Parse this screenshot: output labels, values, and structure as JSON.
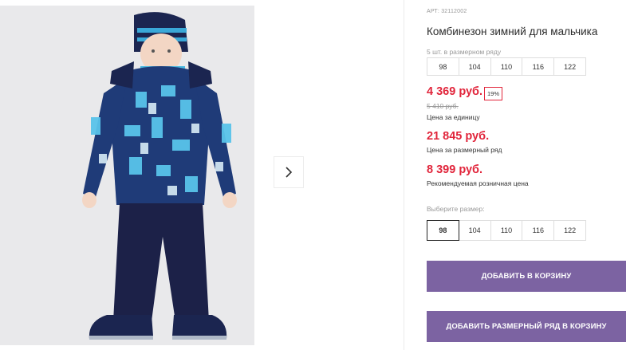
{
  "product": {
    "article": "АРТ: 32112002",
    "title": "Комбинезон зимний для мальчика",
    "pack_label": "5 шт. в размерном ряду",
    "pack_sizes": [
      "98",
      "104",
      "110",
      "116",
      "122"
    ],
    "price": "4 369 руб.",
    "discount_badge": "19%",
    "old_price": "5 410 руб.",
    "price_note": "Цена за единицу",
    "row_price": "21 845 руб.",
    "row_price_note": "Цена за размерный ряд",
    "rrp": "8 399 руб.",
    "rrp_note": "Рекомендуемая розничная цена",
    "choose_size_label": "Выберите размер:",
    "sizes": [
      "98",
      "104",
      "110",
      "116",
      "122"
    ],
    "selected_size": "98",
    "add_to_cart": "ДОБАВИТЬ В КОРЗИНУ",
    "add_row_to_cart": "ДОБАВИТЬ РАЗМЕРНЫЙ РЯД В КОРЗИНУ"
  },
  "colors": {
    "price_red": "#e1253b",
    "button_purple": "#7c63a2"
  },
  "icons": {
    "next": "chevron-right-icon"
  }
}
